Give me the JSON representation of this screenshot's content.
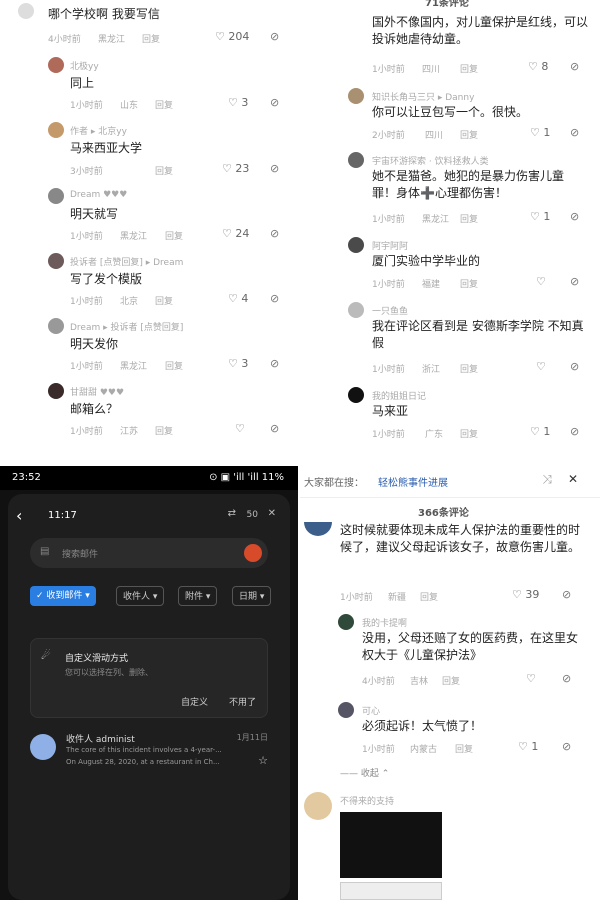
{
  "tl": {
    "comments": [
      {
        "text": "哪个学校啊 我要写信",
        "meta": "4小时前",
        "loc": "黑龙江",
        "reply": "回复",
        "likes": "204"
      },
      {
        "name": "北极yy",
        "text": "同上",
        "meta": "1小时前",
        "loc": "山东",
        "reply": "回复",
        "likes": "3"
      },
      {
        "name": "作者 ▸ 北京yy",
        "text": "马来西亚大学",
        "meta": "3小时前",
        "loc": "",
        "reply": "回复",
        "likes": "23"
      },
      {
        "name": "Dream ♥♥♥",
        "text": "明天就写",
        "meta": "1小时前",
        "loc": "黑龙江",
        "reply": "回复",
        "likes": "24"
      },
      {
        "name": "投诉者 [点赞回复] ▸ Dream",
        "text": "写了发个模版",
        "meta": "1小时前",
        "loc": "北京",
        "reply": "回复",
        "likes": "4"
      },
      {
        "name": "Dream ▸ 投诉者 [点赞回复]",
        "text": "明天发你",
        "meta": "1小时前",
        "loc": "黑龙江",
        "reply": "回复",
        "likes": "3"
      },
      {
        "name": "甘甜甜 ♥♥♥",
        "text": "邮箱么？",
        "meta": "1小时前",
        "loc": "江苏",
        "reply": "回复",
        "likes": ""
      }
    ]
  },
  "tr": {
    "header": "71条评论",
    "comments": [
      {
        "name": "",
        "text": "国外不像国内，对儿童保护是红线，可以投诉她虐待幼童。",
        "meta": "1小时前",
        "loc": "四川",
        "reply": "回复",
        "likes": "8"
      },
      {
        "name": "知识长角马三只 ▸ Danny",
        "text": "你可以让豆包写一个。很快。",
        "meta": "2小时前",
        "loc": "四川",
        "reply": "回复",
        "likes": "1"
      },
      {
        "name": "宇宙环游探索 · 饮料拯救人类",
        "text": "她不是猫爸。她犯的是暴力伤害儿童罪！身体➕心理都伤害！",
        "meta": "1小时前",
        "loc": "黑龙江",
        "reply": "回复",
        "likes": "1"
      },
      {
        "name": "阿宇阿阿",
        "text": "厦门实验中学毕业的",
        "meta": "1小时前",
        "loc": "福建",
        "reply": "回复",
        "likes": ""
      },
      {
        "name": "一只鱼鱼",
        "text": "我在评论区看到是 安德斯李学院 不知真假",
        "meta": "1小时前",
        "loc": "浙江",
        "reply": "回复",
        "likes": ""
      },
      {
        "name": "我的姐姐日记",
        "text": "马来亚",
        "meta": "1小时前",
        "loc": "广东",
        "reply": "回复",
        "likes": "1"
      }
    ]
  },
  "bl": {
    "status_time": "23:52",
    "status_right": "⊙ ▣ 'ill 'ill 11%",
    "header_time": "11:17",
    "header_right": "50",
    "search_placeholder": "搜索邮件",
    "filters": [
      "收到邮件 ▾",
      "收件人 ▾",
      "附件 ▾",
      "日期 ▾"
    ],
    "card_title": "自定义滑动方式",
    "card_desc": "您可以选择在列、删除、",
    "card_btn1": "自定义",
    "card_btn2": "不用了",
    "mail_sender": "收件人 administ",
    "mail_date": "1月11日",
    "mail_line1": "The core of this incident involves a 4-year-...",
    "mail_line2": "On August 28, 2020, at a restaurant in Ch..."
  },
  "br": {
    "notice_prefix": "大家都在搜：",
    "notice_link": "轻松熊事件进展",
    "header": "366条评论",
    "comments": [
      {
        "text": "这时候就要体现未成年人保护法的重要性的时候了，建议父母起诉该女子，故意伤害儿童。",
        "meta": "1小时前",
        "loc": "新疆",
        "reply": "回复",
        "likes": "39"
      },
      {
        "name": "我的卡提啊",
        "text": "没用，父母还赔了女的医药费，在这里女权大于《儿童保护法》",
        "meta": "4小时前",
        "loc": "吉林",
        "reply": "回复",
        "likes": ""
      },
      {
        "name": "可心",
        "text": "必须起诉！太气愤了！",
        "meta": "1小时前",
        "loc": "内蒙古",
        "reply": "回复",
        "likes": "1"
      }
    ],
    "collapse": "收起 ⌃",
    "last_name": "不得来的支持"
  },
  "colors": {
    "dark_bg": "#111111",
    "accent": "#2a7de1",
    "brand": "#d84b2a"
  }
}
